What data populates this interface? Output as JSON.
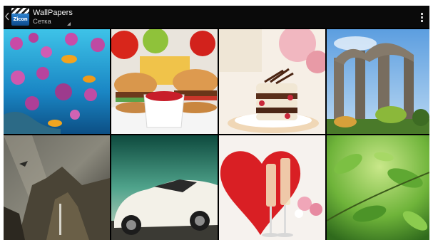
{
  "action_bar": {
    "app_icon_text": "Zicon",
    "title": "WallPapers",
    "subtitle": "Сетка",
    "back_icon": "chevron-left-icon",
    "overflow_icon": "more-vert-icon"
  },
  "grid": {
    "columns": 4,
    "rows": 2,
    "tiles": [
      {
        "subject": "jellyfish-reef"
      },
      {
        "subject": "burgers-fries"
      },
      {
        "subject": "chocolate-dessert"
      },
      {
        "subject": "stone-ruins"
      },
      {
        "subject": "storm-cliffs"
      },
      {
        "subject": "white-sports-car"
      },
      {
        "subject": "red-heart-champagne"
      },
      {
        "subject": "green-leaves"
      }
    ]
  },
  "colors": {
    "action_bar_bg": "#0a0a0a",
    "frame_bg": "#000000",
    "title_text": "#f2f2f2",
    "subtitle_text": "#bdbdbd"
  }
}
